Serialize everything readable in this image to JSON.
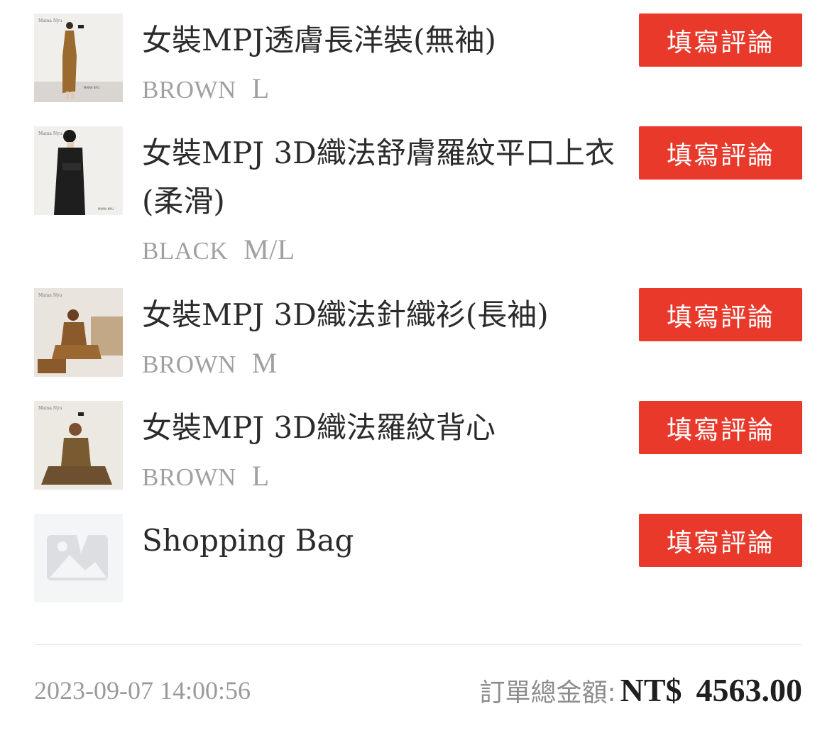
{
  "items": [
    {
      "name": "女裝MPJ透膚長洋裝(無袖)",
      "color": "BROWN",
      "size": "L",
      "review_label": "填寫評論",
      "thumbnail": "model-brown-dress-photo",
      "thumbnail_color": "#9a6a2e"
    },
    {
      "name": "女裝MPJ 3D織法舒膚羅紋平口上衣(柔滑)",
      "color": "BLACK",
      "size": "M/L",
      "review_label": "填寫評論",
      "thumbnail": "model-black-top-photo",
      "thumbnail_color": "#1e1e1e"
    },
    {
      "name": "女裝MPJ 3D織法針織衫(長袖)",
      "color": "BROWN",
      "size": "M",
      "review_label": "填寫評論",
      "thumbnail": "model-brown-cardigan-photo",
      "thumbnail_color": "#8a5a2a"
    },
    {
      "name": "女裝MPJ 3D織法羅紋背心",
      "color": "BROWN",
      "size": "L",
      "review_label": "填寫評論",
      "thumbnail": "model-brown-vest-photo",
      "thumbnail_color": "#7a5a30"
    },
    {
      "name": "Shopping Bag",
      "color": "",
      "size": "",
      "review_label": "填寫評論",
      "thumbnail": "image-placeholder-icon",
      "thumbnail_color": "#d8dadd"
    }
  ],
  "footer": {
    "datetime": "2023-09-07 14:00:56",
    "total_label": "訂單總金額:",
    "currency": "NT$",
    "total_amount": "4563.00"
  },
  "colors": {
    "review_button_bg": "#e8392b",
    "variant_text": "#a0a0a0",
    "footer_muted": "#9a9a9a"
  }
}
